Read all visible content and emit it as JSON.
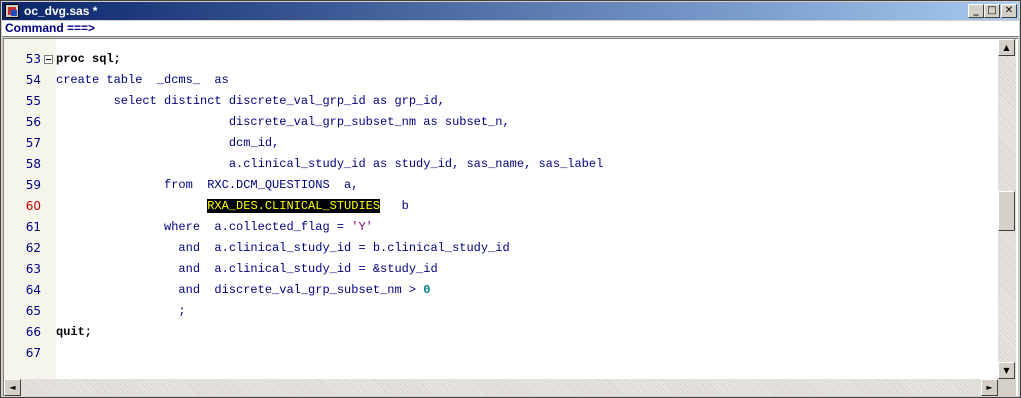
{
  "window": {
    "title": "oc_dvg.sas *",
    "controls": {
      "minimize": "_",
      "maximize": "□",
      "close": "✕"
    }
  },
  "command": {
    "label": "Command ===>",
    "value": ""
  },
  "editor": {
    "lines": [
      {
        "num": "53",
        "fold": true,
        "segs": [
          [
            "proc sql;",
            "kw"
          ]
        ]
      },
      {
        "num": "54",
        "segs": [
          [
            "create table  _dcms_  as",
            ""
          ]
        ]
      },
      {
        "num": "55",
        "segs": [
          [
            "        select distinct discrete_val_grp_id as grp_id,",
            ""
          ]
        ]
      },
      {
        "num": "56",
        "segs": [
          [
            "                        discrete_val_grp_subset_nm as subset_n,",
            ""
          ]
        ]
      },
      {
        "num": "57",
        "segs": [
          [
            "                        dcm_id,",
            ""
          ]
        ]
      },
      {
        "num": "58",
        "segs": [
          [
            "                        a.clinical_study_id as study_id, sas_name, sas_label",
            ""
          ]
        ]
      },
      {
        "num": "59",
        "segs": [
          [
            "               from  RXC.DCM_QUESTIONS  a,",
            ""
          ]
        ]
      },
      {
        "num": "60",
        "err": true,
        "segs": [
          [
            "                     ",
            ""
          ],
          [
            "RXA_DES.CLINICAL_STUDIES",
            "hl"
          ],
          [
            "   b",
            ""
          ]
        ]
      },
      {
        "num": "61",
        "segs": [
          [
            "               where  a.collected_flag = ",
            ""
          ],
          [
            "'Y'",
            "str"
          ]
        ]
      },
      {
        "num": "62",
        "segs": [
          [
            "                 and  a.clinical_study_id = b.clinical_study_id",
            ""
          ]
        ]
      },
      {
        "num": "63",
        "segs": [
          [
            "                 and  a.clinical_study_id = &study_id",
            ""
          ]
        ]
      },
      {
        "num": "64",
        "segs": [
          [
            "                 and  discrete_val_grp_subset_nm > ",
            ""
          ],
          [
            "0",
            "num"
          ]
        ]
      },
      {
        "num": "65",
        "segs": [
          [
            "                 ;",
            ""
          ]
        ]
      },
      {
        "num": "66",
        "segs": [
          [
            "quit;",
            "kw"
          ]
        ]
      },
      {
        "num": "67",
        "segs": [
          [
            "",
            ""
          ]
        ]
      }
    ]
  },
  "scroll": {
    "up": "▲",
    "down": "▼",
    "left": "◄",
    "right": "►"
  }
}
